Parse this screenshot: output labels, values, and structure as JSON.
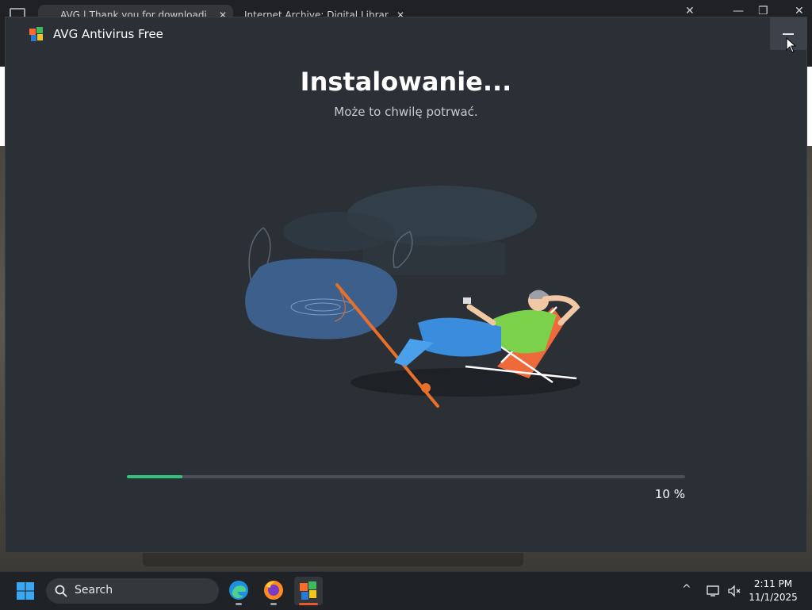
{
  "browser": {
    "tabs": [
      {
        "label": "AVG | Thank you for downloadi"
      },
      {
        "label": "Internet Archive: Digital Librar"
      }
    ]
  },
  "installer": {
    "app_title": "AVG Antivirus Free",
    "heading": "Instalowanie...",
    "subheading": "Może to chwilę potrwać.",
    "progress": {
      "fraction": 0.1,
      "label": "10 %"
    }
  },
  "taskbar": {
    "search_label": "Search",
    "clock_time": "2:11 PM",
    "clock_date": "11/1/2025"
  },
  "colors": {
    "window_bg": "#2b2f36",
    "progress_fill": "#34c27a",
    "progress_track": "#4a4f57",
    "taskbar_bg": "#1f2227"
  },
  "icons": [
    "windows-start-icon",
    "search-icon",
    "edge-icon",
    "firefox-icon",
    "avg-icon",
    "chevron-up-icon",
    "network-icon",
    "volume-muted-icon",
    "avg-logo-icon",
    "minimize-icon"
  ]
}
